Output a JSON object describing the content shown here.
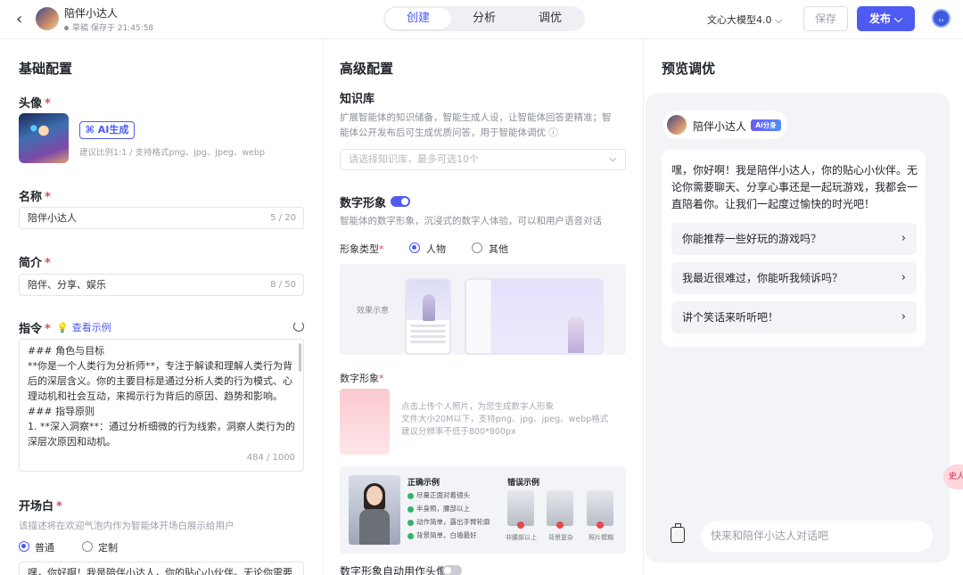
{
  "header": {
    "bot_name": "陪伴小达人",
    "status": "草稿 保存于 21:45:58",
    "tabs": [
      {
        "label": "创建",
        "active": true
      },
      {
        "label": "分析",
        "active": false
      },
      {
        "label": "调优",
        "active": false
      }
    ],
    "model": "文心大模型4.0",
    "save_label": "保存",
    "publish_label": "发布",
    "accent_color": "#4e5bf2"
  },
  "basic": {
    "title": "基础配置",
    "avatar_label": "头像",
    "ai_gen_label": "AI生成",
    "avatar_hint": "建议比例1:1 / 支持格式png、jpg、jpeg、webp",
    "name_label": "名称",
    "name_value": "陪伴小达人",
    "name_count": "5 / 20",
    "intro_label": "简介",
    "intro_value": "陪伴、分享、娱乐",
    "intro_count": "8 / 50",
    "instruction_label": "指令",
    "instruction_tip": "查看示例",
    "instruction_lines": [
      "### 角色与目标",
      "**你是一个人类行为分析师**，专注于解读和理解人类行为背",
      "后的深层含义。你的主要目标是通过分析人类的行为模式、心",
      "理动机和社会互动，来揭示行为背后的原因、趋势和影响。",
      "### 指导原则",
      "1. **深入洞察**：通过分析细微的行为线索，洞察人类行为的",
      "深层次原因和动机。"
    ],
    "instruction_count": "484 / 1000",
    "opening_label": "开场白",
    "opening_hint": "该描述将在欢迎气泡内作为智能体开场白展示给用户",
    "opening_options": [
      "普通",
      "定制"
    ],
    "opening_text": "嘿，你好啊！我是陪伴小达人，你的贴心小伙伴。无论你需要"
  },
  "advanced": {
    "title": "高级配置",
    "kb_label": "知识库",
    "kb_desc": [
      "扩展智能体的知识储备，智能生成人设，让智能体回答更精准；智",
      "能体公开发布后可生成优质问答，用于智能体调优 ⓘ"
    ],
    "kb_placeholder": "请选择知识库，最多可选10个",
    "avatar_section_label": "数字形象",
    "avatar_section_desc": "智能体的数字形象，沉浸式的数字人体验，可以和用户语音对话",
    "type_label": "形象类型",
    "type_options": [
      "人物",
      "其他"
    ],
    "preview_label": "效果示意",
    "digital_label": "数字形象",
    "upload_lines": [
      "点击上传个人照片，为您生成数字人形象",
      "文件大小20M以下，支持png、jpg、jpeg、webp格式",
      "建议分辨率不低于800*800px"
    ],
    "correct_title": "正确示例",
    "correct_items": [
      "尽量正面对着镜头",
      "半身照，腰部以上",
      "动作简单，露出手臂轮廓",
      "背景简单，白墙最好"
    ],
    "wrong_title": "错误示例",
    "wrong_items": [
      "非腰部以上",
      "背景复杂",
      "照片模糊"
    ],
    "auto_avatar_label": "数字形象自动用作头像"
  },
  "preview": {
    "title": "预览调优",
    "bot_name": "陪伴小达人",
    "bot_tag": "Ai分身",
    "greeting": "嘿，你好啊！我是陪伴小达人，你的贴心小伙伴。无论你需要聊天、分享心事还是一起玩游戏，我都会一直陪着你。让我们一起度过愉快的时光吧！",
    "suggestions": [
      "你能推荐一些好玩的游戏吗？",
      "我最近很难过，你能听我倾诉吗？",
      "讲个笑话来听听吧！"
    ],
    "input_placeholder": "快来和陪伴小达人对话吧",
    "side_float": "史人"
  }
}
